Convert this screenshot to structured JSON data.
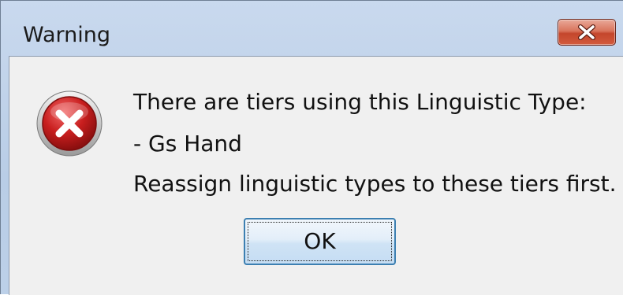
{
  "window": {
    "title": "Warning"
  },
  "icons": {
    "close": "close-x-icon",
    "message": "error-icon"
  },
  "message": {
    "line1": "There are tiers using this Linguistic Type:",
    "line2": "- Gs Hand",
    "line3": "Reassign linguistic types to these tiers first."
  },
  "buttons": {
    "ok_label": "OK"
  },
  "colors": {
    "titlebar": "#bcd0e8",
    "client_bg": "#f0f0f0",
    "close_button": "#c4462c",
    "error_red": "#c81e1e",
    "ok_border": "#3c7fb1"
  }
}
